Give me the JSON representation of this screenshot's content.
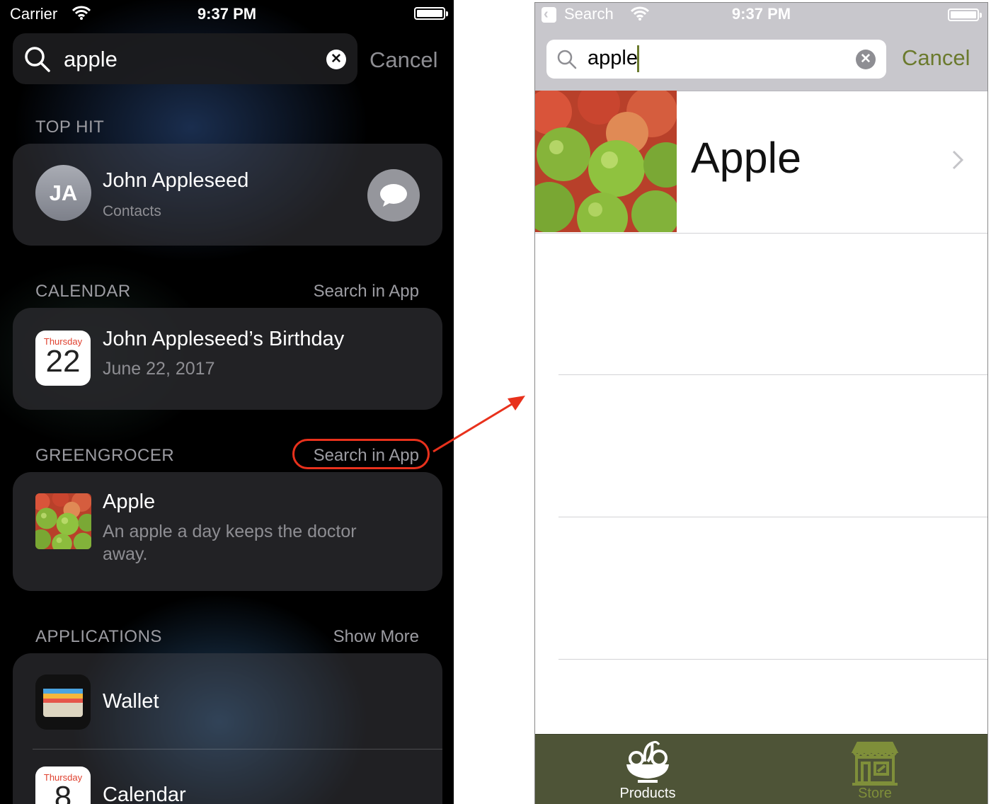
{
  "left": {
    "status": {
      "carrier": "Carrier",
      "time": "9:37 PM"
    },
    "search": {
      "query": "apple",
      "cancel": "Cancel"
    },
    "top_hit": {
      "header": "TOP HIT",
      "initials": "JA",
      "name": "John Appleseed",
      "subtitle": "Contacts"
    },
    "calendar": {
      "header": "CALENDAR",
      "action": "Search in App",
      "icon_day": "Thursday",
      "icon_date": "22",
      "title": "John Appleseed’s Birthday",
      "date": "June 22, 2017"
    },
    "greengrocer": {
      "header": "GREENGROCER",
      "action": "Search in App",
      "title": "Apple",
      "desc_line1": "An apple a day keeps the doctor",
      "desc_line2": "away."
    },
    "applications": {
      "header": "APPLICATIONS",
      "action": "Show More",
      "items": [
        {
          "label": "Wallet"
        },
        {
          "label": "Calendar",
          "icon_day": "Thursday",
          "icon_date": "8"
        }
      ]
    }
  },
  "right": {
    "status": {
      "back": "Search",
      "time": "9:37 PM"
    },
    "search": {
      "query": "apple",
      "cancel": "Cancel"
    },
    "result": {
      "title": "Apple"
    },
    "tabs": [
      {
        "label": "Products"
      },
      {
        "label": "Store"
      }
    ]
  },
  "colors": {
    "accent_green": "#6b7a2d",
    "tabbar": "#4e5437",
    "highlight_red": "#e8311c"
  }
}
